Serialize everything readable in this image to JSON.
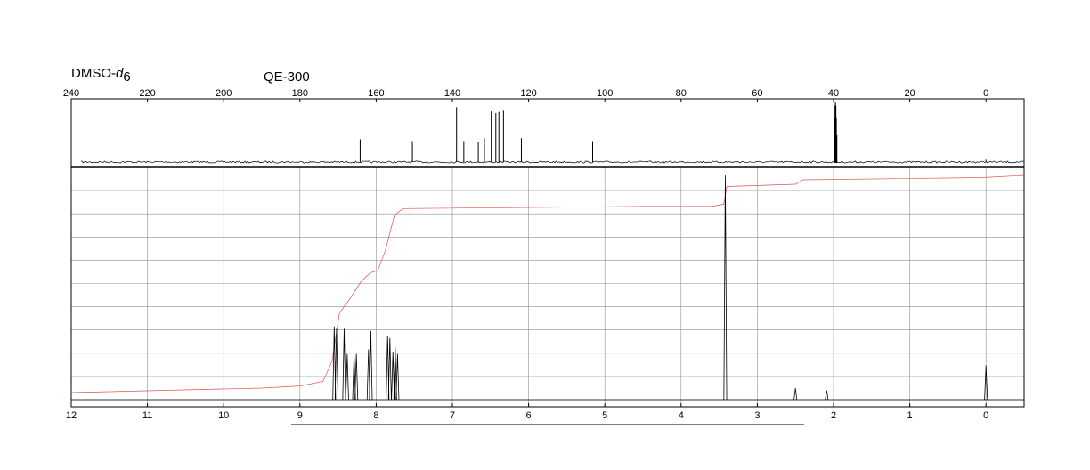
{
  "header": {
    "solvent_prefix": "DMSO-",
    "solvent_d": "d",
    "solvent_sub": "6",
    "instrument": "QE-300"
  },
  "colors": {
    "spectrum": "#000000",
    "integral": "#e05050",
    "grid": "#909090",
    "frame": "#000000"
  },
  "chart_data": [
    {
      "type": "line",
      "name": "13C NMR",
      "x_axis": {
        "ticks": [
          240,
          220,
          200,
          180,
          160,
          140,
          120,
          100,
          80,
          60,
          40,
          20,
          0
        ],
        "tick_labels": [
          "240",
          "220",
          "200",
          "180",
          "160",
          "140",
          "120",
          "100",
          "80",
          "60",
          "40",
          "20",
          "0"
        ],
        "range": [
          240,
          -10
        ],
        "reversed": true,
        "position": "top"
      },
      "peaks": [
        {
          "ppm": 164.2,
          "rel_height": 0.38
        },
        {
          "ppm": 150.5,
          "rel_height": 0.35
        },
        {
          "ppm": 138.9,
          "rel_height": 0.92
        },
        {
          "ppm": 137.0,
          "rel_height": 0.35
        },
        {
          "ppm": 133.2,
          "rel_height": 0.33
        },
        {
          "ppm": 131.6,
          "rel_height": 0.4
        },
        {
          "ppm": 129.8,
          "rel_height": 0.85
        },
        {
          "ppm": 128.6,
          "rel_height": 0.82
        },
        {
          "ppm": 127.8,
          "rel_height": 0.84
        },
        {
          "ppm": 126.6,
          "rel_height": 0.86
        },
        {
          "ppm": 121.9,
          "rel_height": 0.4
        },
        {
          "ppm": 103.2,
          "rel_height": 0.35
        },
        {
          "ppm": 0.0,
          "rel_height": 0.04
        }
      ],
      "solvent_multiplet": {
        "ppm": 39.5,
        "rel_height": 1.0
      }
    },
    {
      "type": "line",
      "name": "1H NMR",
      "x_axis": {
        "ticks": [
          12,
          11,
          10,
          9,
          8,
          7,
          6,
          5,
          4,
          3,
          2,
          1,
          0
        ],
        "tick_labels": [
          "12",
          "11",
          "10",
          "9",
          "8",
          "7",
          "6",
          "5",
          "4",
          "3",
          "2",
          "1",
          "0"
        ],
        "range": [
          12,
          -0.5
        ],
        "reversed": true,
        "position": "bottom"
      },
      "grid": true,
      "peaks": [
        {
          "ppm": 8.55,
          "rel_height": 0.32
        },
        {
          "ppm": 8.52,
          "rel_height": 0.31
        },
        {
          "ppm": 8.42,
          "rel_height": 0.31
        },
        {
          "ppm": 8.38,
          "rel_height": 0.2
        },
        {
          "ppm": 8.29,
          "rel_height": 0.2
        },
        {
          "ppm": 8.26,
          "rel_height": 0.2
        },
        {
          "ppm": 8.1,
          "rel_height": 0.22
        },
        {
          "ppm": 8.07,
          "rel_height": 0.3
        },
        {
          "ppm": 7.85,
          "rel_height": 0.28
        },
        {
          "ppm": 7.82,
          "rel_height": 0.27
        },
        {
          "ppm": 7.78,
          "rel_height": 0.21
        },
        {
          "ppm": 7.75,
          "rel_height": 0.23
        },
        {
          "ppm": 7.72,
          "rel_height": 0.2
        },
        {
          "ppm": 3.42,
          "rel_height": 0.98
        },
        {
          "ppm": 2.5,
          "rel_height": 0.05
        },
        {
          "ppm": 2.09,
          "rel_height": 0.04
        },
        {
          "ppm": 0.0,
          "rel_height": 0.15
        }
      ],
      "integral_curve": [
        [
          12.0,
          0.02
        ],
        [
          9.5,
          0.04
        ],
        [
          9.0,
          0.05
        ],
        [
          8.7,
          0.07
        ],
        [
          8.58,
          0.16
        ],
        [
          8.48,
          0.38
        ],
        [
          8.35,
          0.44
        ],
        [
          8.2,
          0.52
        ],
        [
          8.08,
          0.56
        ],
        [
          7.98,
          0.57
        ],
        [
          7.88,
          0.66
        ],
        [
          7.76,
          0.82
        ],
        [
          7.65,
          0.85
        ],
        [
          4.5,
          0.86
        ],
        [
          3.6,
          0.86
        ],
        [
          3.44,
          0.87
        ],
        [
          3.4,
          0.95
        ],
        [
          2.5,
          0.96
        ],
        [
          2.4,
          0.98
        ],
        [
          0.05,
          0.99
        ],
        [
          -0.5,
          1.0
        ]
      ]
    }
  ]
}
